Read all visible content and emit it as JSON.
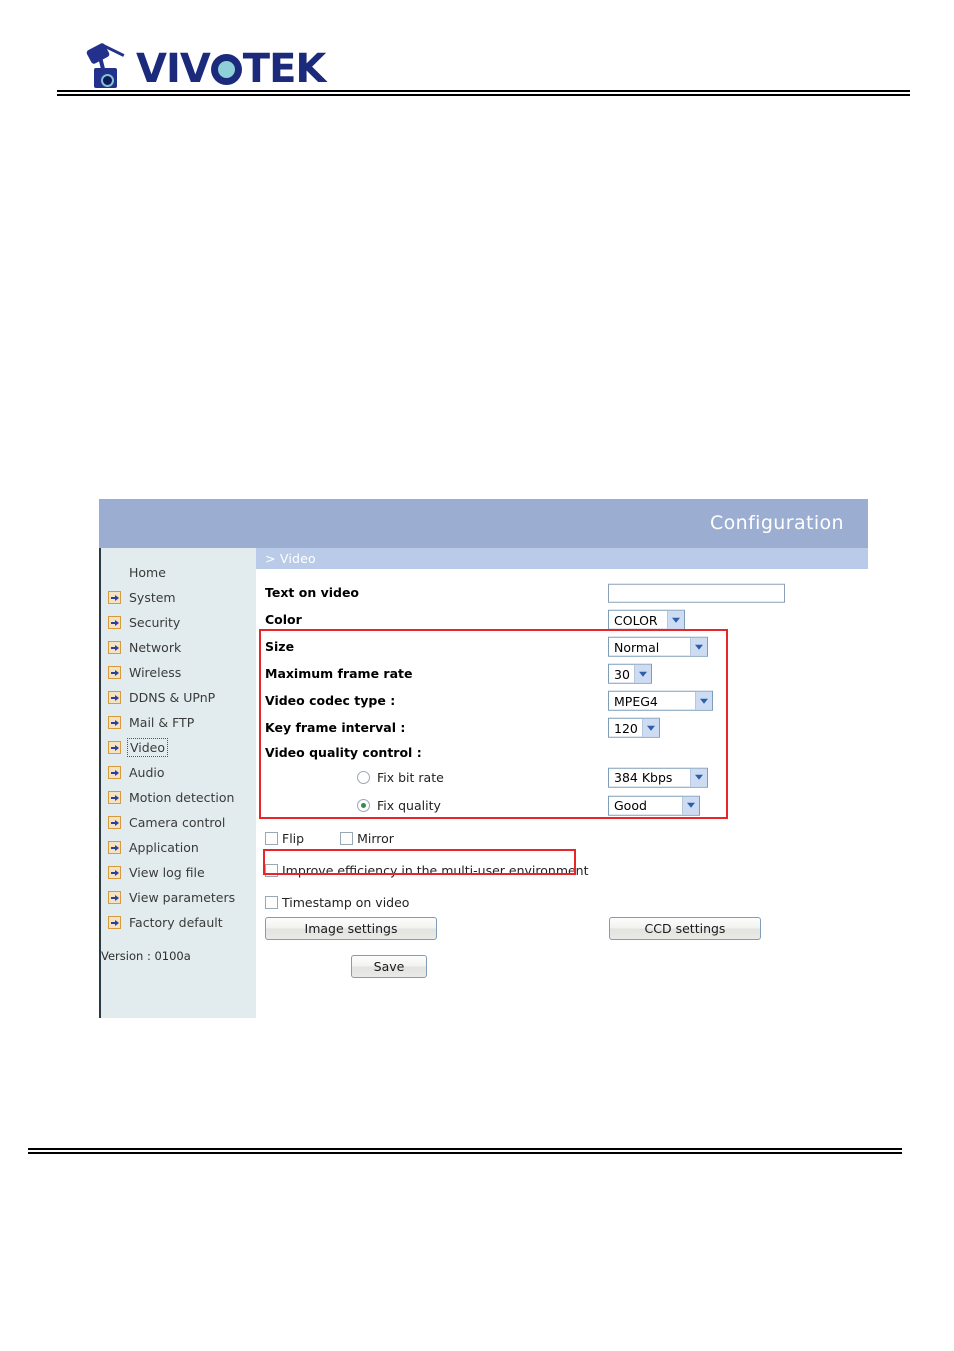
{
  "brand": {
    "name": "VIVOTEK",
    "logo_icon": "network-camera-icon"
  },
  "config": {
    "title": "Configuration",
    "breadcrumb": "> Video"
  },
  "sidebar": {
    "items": [
      {
        "label": "Home",
        "icon": null,
        "focused": false
      },
      {
        "label": "System",
        "icon": "arrow-right-icon",
        "focused": false
      },
      {
        "label": "Security",
        "icon": "arrow-right-icon",
        "focused": false
      },
      {
        "label": "Network",
        "icon": "arrow-right-icon",
        "focused": false
      },
      {
        "label": "Wireless",
        "icon": "arrow-right-icon",
        "focused": false
      },
      {
        "label": "DDNS & UPnP",
        "icon": "arrow-right-icon",
        "focused": false
      },
      {
        "label": "Mail & FTP",
        "icon": "arrow-right-icon",
        "focused": false
      },
      {
        "label": "Video",
        "icon": "arrow-right-icon",
        "focused": true
      },
      {
        "label": "Audio",
        "icon": "arrow-right-icon",
        "focused": false
      },
      {
        "label": "Motion detection",
        "icon": "arrow-right-icon",
        "focused": false
      },
      {
        "label": "Camera control",
        "icon": "arrow-right-icon",
        "focused": false
      },
      {
        "label": "Application",
        "icon": "arrow-right-icon",
        "focused": false
      },
      {
        "label": "View log file",
        "icon": "arrow-right-icon",
        "focused": false
      },
      {
        "label": "View parameters",
        "icon": "arrow-right-icon",
        "focused": false
      },
      {
        "label": "Factory default",
        "icon": "arrow-right-icon",
        "focused": false
      }
    ],
    "version": "Version : 0100a"
  },
  "form": {
    "text_on_video": {
      "label": "Text on video",
      "value": "",
      "placeholder": ""
    },
    "color": {
      "label": "Color",
      "value": "COLOR"
    },
    "size": {
      "label": "Size",
      "value": "Normal"
    },
    "max_frame_rate": {
      "label": "Maximum frame rate",
      "value": "30"
    },
    "video_codec_type": {
      "label": "Video codec type :",
      "value": "MPEG4"
    },
    "key_frame_interval": {
      "label": "Key frame interval :",
      "value": "120"
    },
    "video_quality_control": {
      "label": "Video quality control :"
    },
    "fix_bit_rate": {
      "label": "Fix bit rate",
      "selected": false,
      "value": "384 Kbps"
    },
    "fix_quality": {
      "label": "Fix quality",
      "selected": true,
      "value": "Good"
    },
    "flip": {
      "label": "Flip",
      "checked": false
    },
    "mirror": {
      "label": "Mirror",
      "checked": false
    },
    "improve_efficiency": {
      "label": "Improve efficiency in the multi-user environment",
      "checked": false
    },
    "timestamp_on_video": {
      "label": "Timestamp on video",
      "checked": false
    },
    "buttons": {
      "image_settings": "Image settings",
      "ccd_settings": "CCD settings",
      "save": "Save"
    }
  },
  "annotations": {
    "highlight_color": "#e8262a",
    "boxes": [
      {
        "name": "video-quality-settings-highlight"
      },
      {
        "name": "improve-efficiency-highlight"
      }
    ]
  },
  "colors": {
    "titlebar": "#9badd1",
    "breadcrumb_bar": "#bacbe9",
    "sidebar_bg": "#e2ecee",
    "logo_blue": "#1b2a7a",
    "logo_teal": "#8fd0d8"
  }
}
